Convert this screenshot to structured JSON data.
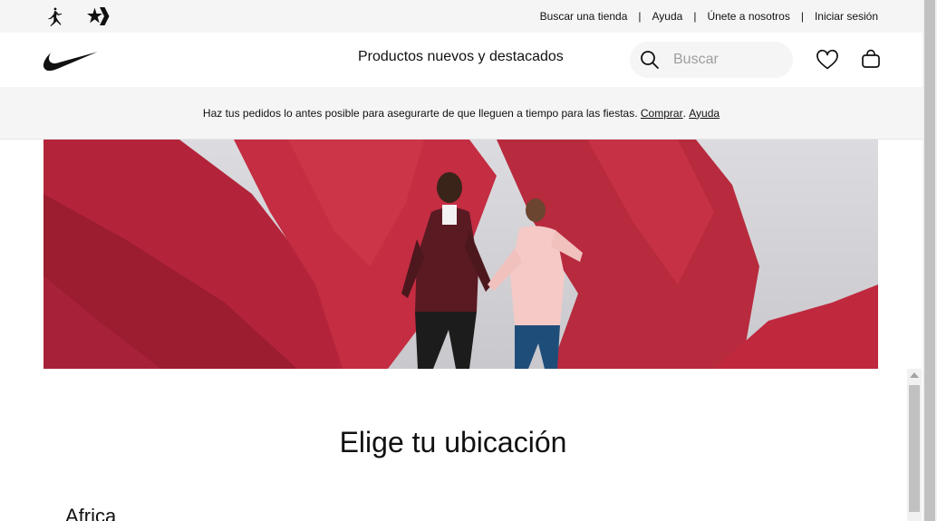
{
  "utility_bar": {
    "brand_icons": [
      "jordan-jumpman-icon",
      "converse-star-icon"
    ],
    "links": [
      "Buscar una tienda",
      "Ayuda",
      "Únete a nosotros",
      "Iniciar sesión"
    ],
    "separator": "|"
  },
  "main_nav": {
    "logo": "nike-swoosh-icon",
    "menu_item": "Productos nuevos y destacados",
    "search": {
      "placeholder": "Buscar",
      "value": ""
    },
    "icons": [
      "search-icon",
      "heart-icon",
      "bag-icon"
    ]
  },
  "promo": {
    "message": "Haz tus pedidos lo antes posible para asegurarte de que lleguen a tiempo para las fiestas.",
    "shop_link": "Comprar",
    "dot": ".",
    "help_link": "Ayuda"
  },
  "location": {
    "title": "Elige tu ubicación",
    "first_region": "Africa"
  },
  "colors": {
    "utility_bg": "#f5f5f5",
    "text": "#111111",
    "hero_red": "#b3243a",
    "hero_bg": "#d4d3d6"
  }
}
